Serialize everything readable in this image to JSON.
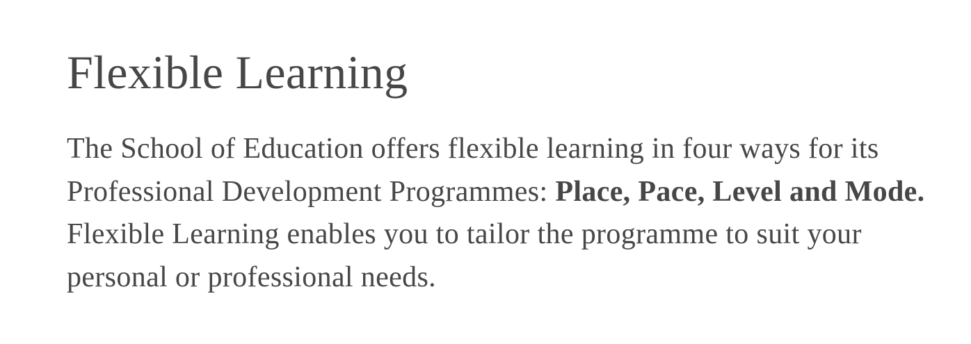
{
  "section": {
    "heading": "Flexible Learning",
    "paragraph": {
      "intro": "The School of Education offers flexible learning in four ways for its Professional Development Programmes: ",
      "emphasis": "Place, Pace, Level and Mode.",
      "rest": " Flexible Learning enables you to tailor the programme to suit your personal or professional needs."
    }
  },
  "colors": {
    "text": "#474747",
    "background": "#ffffff"
  }
}
